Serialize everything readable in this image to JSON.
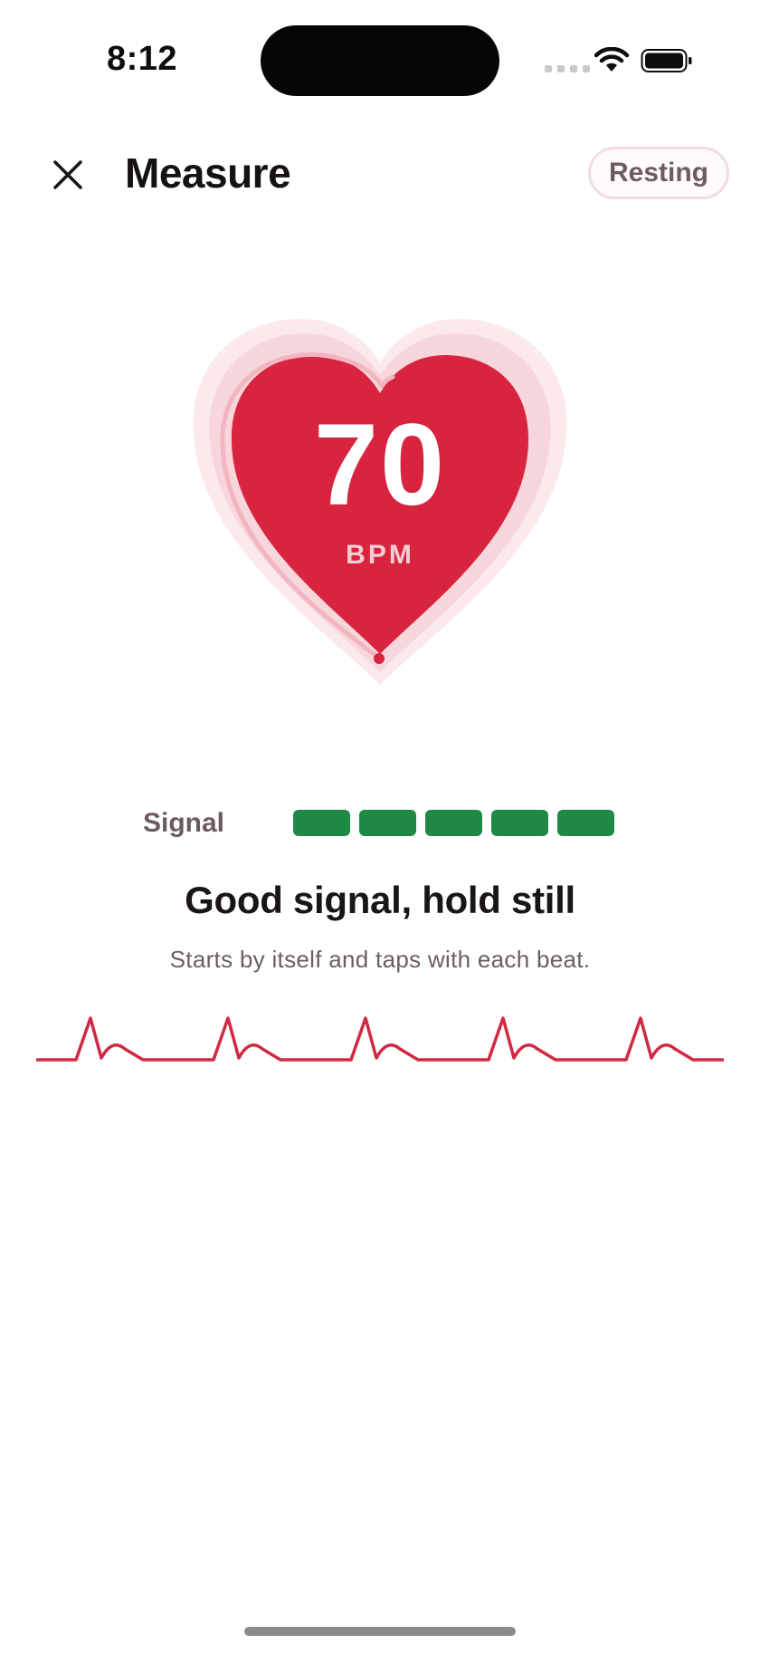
{
  "status_bar": {
    "time": "8:12",
    "wifi_icon": "wifi-icon",
    "battery_icon": "battery-icon"
  },
  "header": {
    "close_icon": "close-icon",
    "title": "Measure",
    "mode_label": "Resting"
  },
  "heart": {
    "value": "70",
    "unit": "BPM",
    "color": "#d8243f"
  },
  "signal": {
    "label": "Signal",
    "level": 5,
    "max": 5,
    "color": "#1e8a46"
  },
  "status": {
    "heading": "Good signal, hold still",
    "subtext": "Starts by itself and taps with each beat."
  },
  "ecg": {
    "color": "#d02a43",
    "beats": 5
  }
}
